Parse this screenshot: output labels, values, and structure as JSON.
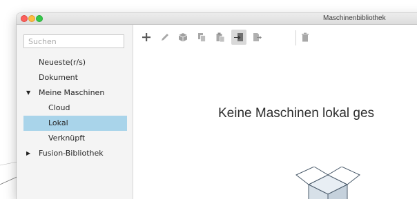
{
  "window": {
    "title": "Maschinenbibliothek"
  },
  "sidebar": {
    "search_placeholder": "Suchen",
    "items": [
      {
        "label": "Neueste(r/s)"
      },
      {
        "label": "Dokument"
      },
      {
        "label": "Meine Maschinen",
        "disclosure": "▼"
      },
      {
        "label": "Cloud"
      },
      {
        "label": "Lokal",
        "selected": true
      },
      {
        "label": "Verknüpft"
      },
      {
        "label": "Fusion-Bibliothek",
        "disclosure": "▶"
      }
    ]
  },
  "toolbar": {
    "icons": [
      "plus-icon",
      "pencil-icon",
      "cube-icon",
      "copy-icon",
      "paste-icon",
      "import-icon",
      "export-icon",
      "trash-icon"
    ],
    "active": "import-icon"
  },
  "main": {
    "empty_message": "Keine Maschinen lokal ges"
  },
  "colors": {
    "selection": "#a9d4ea",
    "icon_gray": "#9b9b9b"
  }
}
